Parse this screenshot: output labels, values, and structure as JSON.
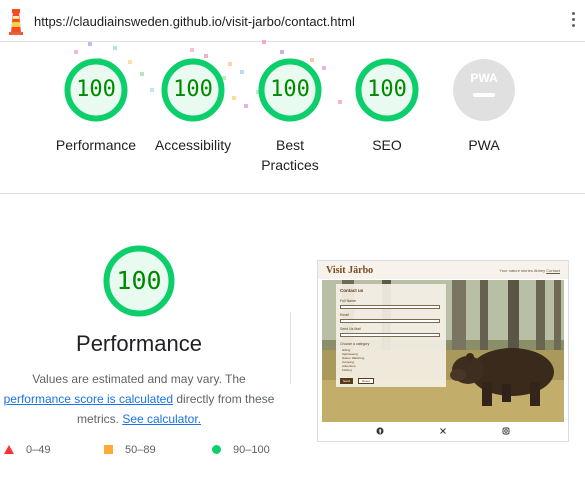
{
  "browser": {
    "url": "https://claudiainsweden.github.io/visit-jarbo/contact.html",
    "logo_icon": "lighthouse-icon",
    "menu_icon": "kebab-menu-icon"
  },
  "colors": {
    "pass": "#0cce6b",
    "pass_text": "#008800",
    "average": "#ffaa33",
    "fail": "#ff3333",
    "na": "#e0e0e0"
  },
  "gauges": [
    {
      "label": "Performance",
      "score": "100"
    },
    {
      "label": "Accessibility",
      "score": "100"
    },
    {
      "label": "Best Practices",
      "score": "100"
    },
    {
      "label": "SEO",
      "score": "100"
    },
    {
      "label": "PWA",
      "score": ""
    }
  ],
  "pwa_badge_text": "PWA",
  "performance": {
    "score": "100",
    "title": "Performance",
    "note_text": "Values are estimated and may vary. The",
    "link_score": "performance score is calculated",
    "mid_text": "directly from these metrics.",
    "link_calculator": "See calculator."
  },
  "legend": [
    {
      "shape": "triangle",
      "range": "0–49"
    },
    {
      "shape": "square",
      "range": "50–89"
    },
    {
      "shape": "circle",
      "range": "90–100"
    }
  ],
  "screenshot": {
    "site_title": "Visit Järbo",
    "nav_text": "Your nature stories  Abbey",
    "nav_active": "Contact",
    "form_title": "Contact us",
    "field_labels": [
      "Full Name",
      "Email",
      "Send Us Mail"
    ],
    "options_label": "Choose a category",
    "options": [
      "Hiking",
      "Sightseeing",
      "Nature Watching",
      "Camping",
      "Adventure",
      "Fishing"
    ],
    "send_label": "Send",
    "reset_label": "Reset",
    "social_icons": [
      "facebook-icon",
      "x-icon",
      "instagram-icon"
    ]
  }
}
